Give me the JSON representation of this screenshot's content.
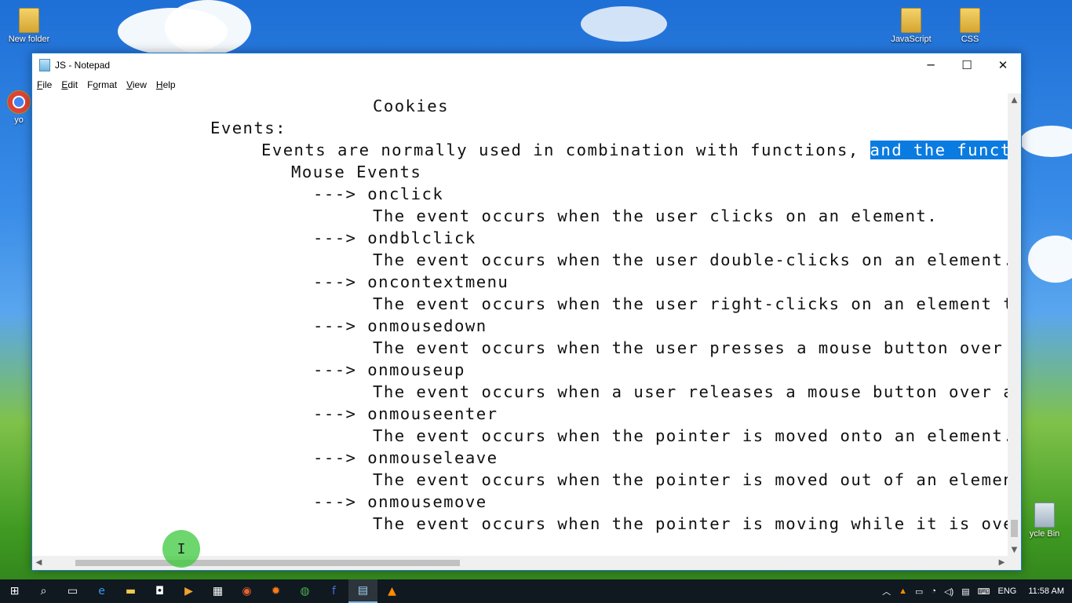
{
  "desktop": {
    "icons": [
      {
        "label": "New folder"
      },
      {
        "label": "JavaScript"
      },
      {
        "label": "CSS"
      },
      {
        "label": "ycle Bin"
      },
      {
        "label": "yo"
      }
    ]
  },
  "window": {
    "title": "JS - Notepad",
    "controls": {
      "minimize": "─",
      "maximize": "☐",
      "close": "✕"
    },
    "menu": [
      {
        "accel": "F",
        "rest": "ile"
      },
      {
        "accel": "E",
        "rest": "dit"
      },
      {
        "accel": "F",
        "rest": "o",
        "tail": "rmat",
        "mid_underline": true,
        "label": "Format"
      },
      {
        "accel": "V",
        "rest": "iew"
      },
      {
        "accel": "H",
        "rest": "elp"
      }
    ],
    "editor": {
      "lines": [
        "Cookies",
        "Events:",
        "Events are normally used in combination with functions, ",
        "Mouse Events",
        "---> onclick",
        "The event occurs when the user clicks on an element.",
        "---> ondblclick",
        "The event occurs when the user double-clicks on an element.",
        "---> oncontextmenu",
        "The event occurs when the user right-clicks on an element to c",
        "---> onmousedown",
        "The event occurs when the user presses a mouse button over an",
        "---> onmouseup",
        "The event occurs when a user releases a mouse button over an e",
        "---> onmouseenter",
        "The event occurs when the pointer is moved onto an element.",
        "---> onmouseleave",
        "The event occurs when the pointer is moved out of an element.",
        "---> onmousemove",
        "The event occurs when the pointer is moving while it is over a"
      ],
      "selected_text": "and the function "
    },
    "cursor_glyph": "I"
  },
  "taskbar": {
    "language": "ENG",
    "time": "11:58 AM"
  }
}
